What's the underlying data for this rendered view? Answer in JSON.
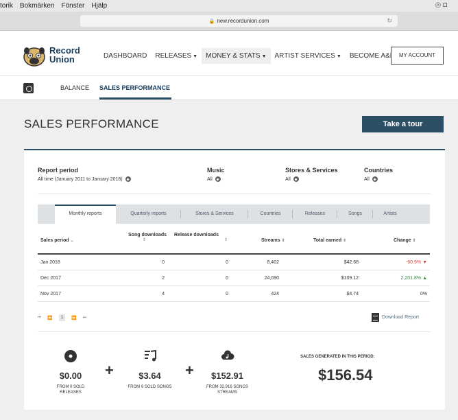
{
  "menubar": {
    "items": [
      "torik",
      "Bokmärken",
      "Fönster",
      "Hjälp"
    ]
  },
  "browser": {
    "url": "new.recordunion.com"
  },
  "brand": {
    "line1": "Record",
    "line2": "Union"
  },
  "nav": {
    "items": [
      "DASHBOARD",
      "RELEASES",
      "MONEY & STATS",
      "ARTIST SERVICES",
      "BECOME A&R"
    ],
    "account": "MY ACCOUNT"
  },
  "subnav": {
    "items": [
      "BALANCE",
      "SALES PERFORMANCE"
    ]
  },
  "page": {
    "title": "SALES PERFORMANCE",
    "tour_button": "Take a tour"
  },
  "filters": [
    {
      "label": "Report period",
      "value": "All time (January 2011 to January 2018)"
    },
    {
      "label": "Music",
      "value": "All"
    },
    {
      "label": "Stores & Services",
      "value": "All"
    },
    {
      "label": "Countries",
      "value": "All"
    }
  ],
  "tabs": [
    "Monthly reports",
    "Quarterly reports",
    "Stores & Services",
    "Countries",
    "Releases",
    "Songs",
    "Artists"
  ],
  "table": {
    "headers": [
      "Sales period",
      "Song downloads",
      "Release downloads",
      "Streams",
      "Total earned",
      "Change"
    ],
    "rows": [
      [
        "Jan 2018",
        "0",
        "0",
        "8,402",
        "$42.68",
        "-60.9%"
      ],
      [
        "Dec 2017",
        "2",
        "0",
        "24,090",
        "$109.12",
        "2,201.8%"
      ],
      [
        "Nov 2017",
        "4",
        "0",
        "424",
        "$4.74",
        "0%"
      ]
    ]
  },
  "pager": {
    "current": "1"
  },
  "download": {
    "label": "Download Report"
  },
  "summary": {
    "releases": {
      "amount": "$0.00",
      "caption1": "FROM 0 SOLD",
      "caption2": "RELEASES"
    },
    "songs": {
      "amount": "$3.64",
      "caption1": "FROM 6 SOLD SONGS"
    },
    "streams": {
      "amount": "$152.91",
      "caption1": "FROM 32,916 SONGS",
      "caption2": "STREAMS"
    },
    "plus": "+",
    "total_label": "SALES GENERATED IN THIS PERIOD:",
    "total_amount": "$156.54"
  }
}
